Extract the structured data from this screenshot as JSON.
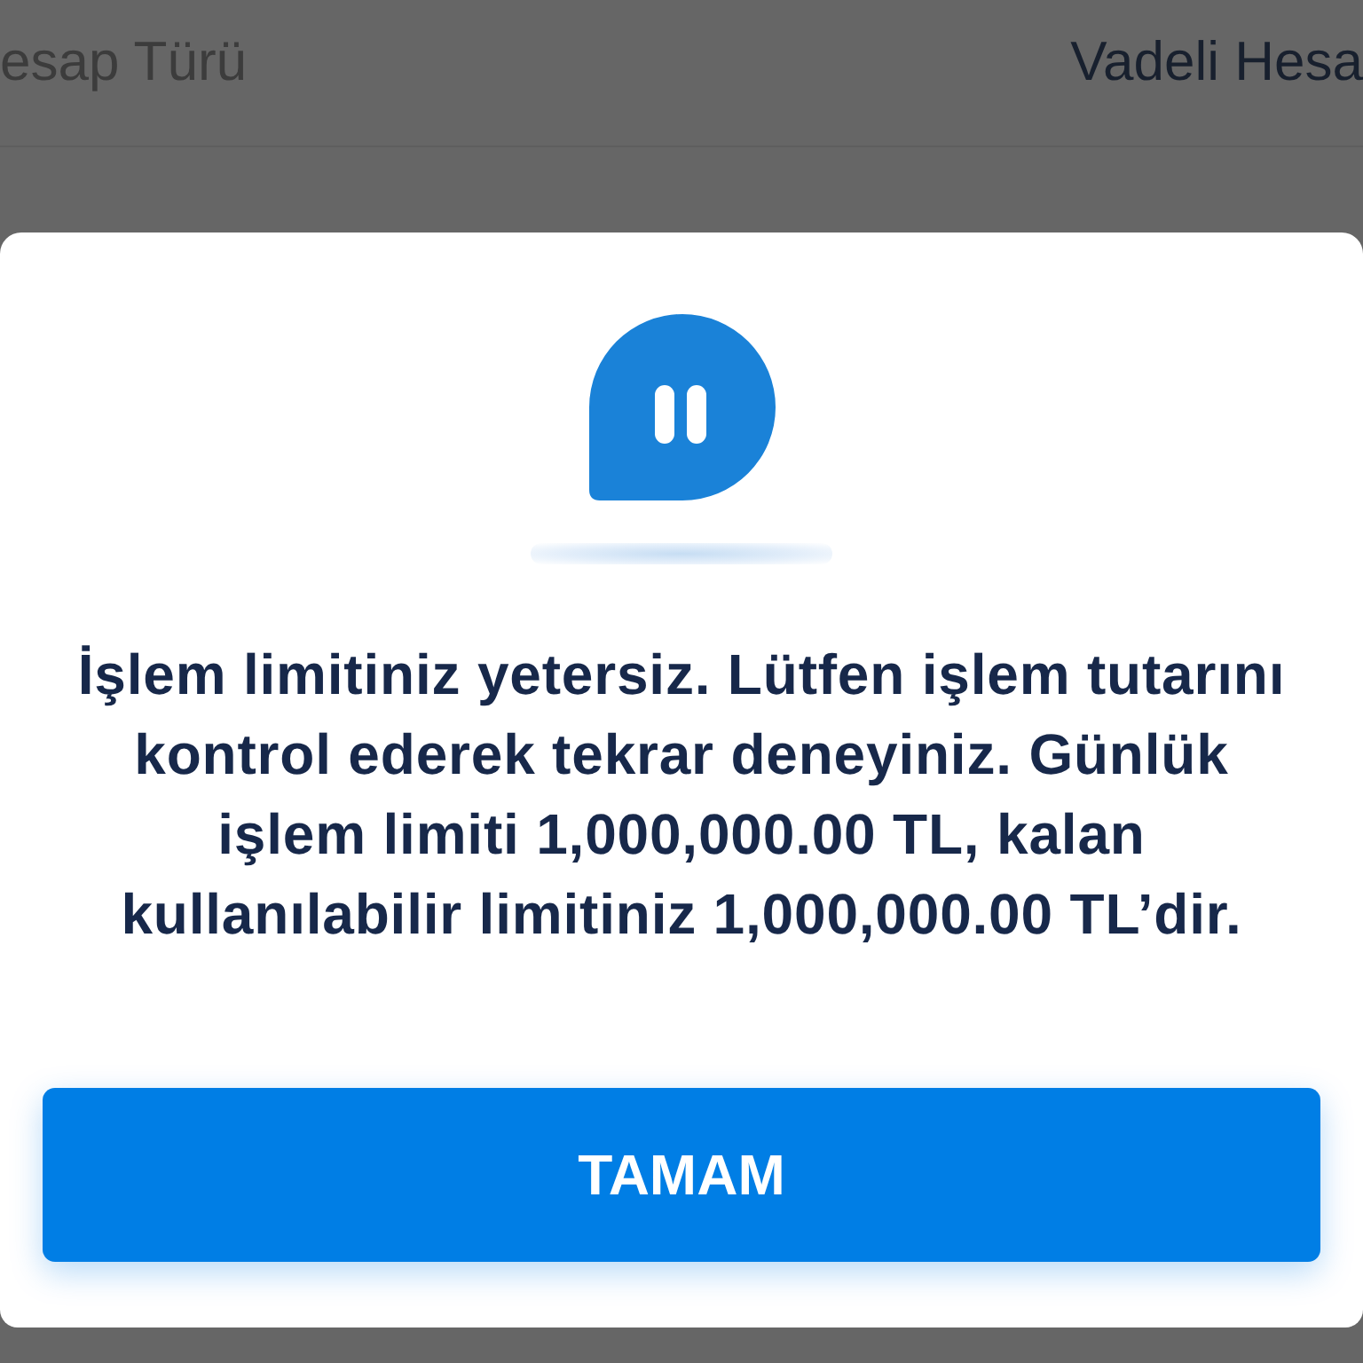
{
  "background": {
    "row": {
      "label": "esap Türü",
      "value": "Vadeli Hesa"
    }
  },
  "dialog": {
    "message_lines": [
      "İşlem limitiniz yetersiz. Lütfen işlem tutarını",
      "kontrol ederek tekrar deneyiniz. Günlük",
      "işlem limiti 1,000,000.00 TL, kalan",
      "kullanılabilir limitiniz 1,000,000.00 TL’dir."
    ],
    "button": "TAMAM"
  }
}
